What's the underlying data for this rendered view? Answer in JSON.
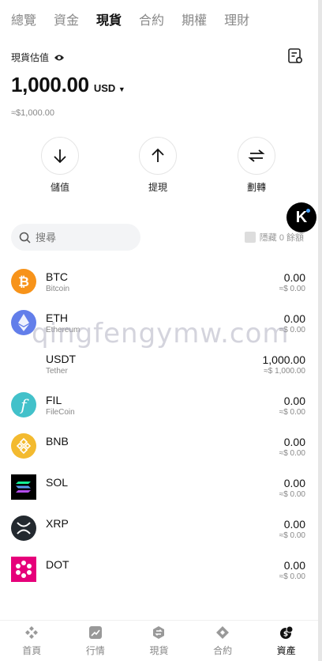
{
  "tabs": [
    "總覽",
    "資金",
    "現貨",
    "合約",
    "期權",
    "理財"
  ],
  "active_tab": 2,
  "header": {
    "valuation_label": "現貨估值",
    "balance": "1,000.00",
    "currency": "USD",
    "fiat_value": "≈$1,000.00"
  },
  "actions": [
    {
      "label": "儲值",
      "icon": "arrow-down-icon"
    },
    {
      "label": "提現",
      "icon": "arrow-up-icon"
    },
    {
      "label": "劃轉",
      "icon": "transfer-icon"
    }
  ],
  "badge_letter": "K",
  "search": {
    "placeholder": "搜尋"
  },
  "hide_zero_label": "隱藏 0 餘額",
  "coins": [
    {
      "symbol": "BTC",
      "name": "Bitcoin",
      "amount": "0.00",
      "fiat": "≈$ 0.00",
      "color": "#f7931a"
    },
    {
      "symbol": "ETH",
      "name": "Ethereum",
      "amount": "0.00",
      "fiat": "≈$ 0.00",
      "color": "#627eea"
    },
    {
      "symbol": "USDT",
      "name": "Tether",
      "amount": "1,000.00",
      "fiat": "≈$ 1,000.00",
      "color": "#ffffff"
    },
    {
      "symbol": "FIL",
      "name": "FileCoin",
      "amount": "0.00",
      "fiat": "≈$ 0.00",
      "color": "#42c1ca"
    },
    {
      "symbol": "BNB",
      "name": "",
      "amount": "0.00",
      "fiat": "≈$ 0.00",
      "color": "#f3ba2f"
    },
    {
      "symbol": "SOL",
      "name": "",
      "amount": "0.00",
      "fiat": "≈$ 0.00",
      "color": "#000000"
    },
    {
      "symbol": "XRP",
      "name": "",
      "amount": "0.00",
      "fiat": "≈$ 0.00",
      "color": "#23292f"
    },
    {
      "symbol": "DOT",
      "name": "",
      "amount": "0.00",
      "fiat": "≈$ 0.00",
      "color": "#e6007a"
    }
  ],
  "watermark": "qingfengymw.com",
  "bottom_nav": [
    {
      "label": "首頁",
      "icon": "home-icon"
    },
    {
      "label": "行情",
      "icon": "market-icon"
    },
    {
      "label": "現貨",
      "icon": "spot-icon"
    },
    {
      "label": "合約",
      "icon": "futures-icon"
    },
    {
      "label": "資產",
      "icon": "assets-icon"
    }
  ],
  "active_nav": 4
}
